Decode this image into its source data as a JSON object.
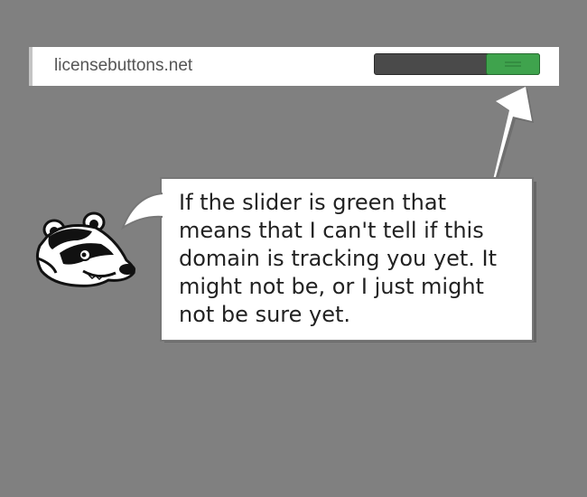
{
  "domain_row": {
    "domain": "licensebuttons.net",
    "slider_state": "green",
    "slider_color": "#3fa34d"
  },
  "tutorial": {
    "message": "If the slider is green that means that I can't tell if this domain is tracking you yet. It might not be, or I just might not be sure yet.",
    "mascot_icon": "badger-icon",
    "arrow_icon": "pointer-arrow-icon"
  }
}
